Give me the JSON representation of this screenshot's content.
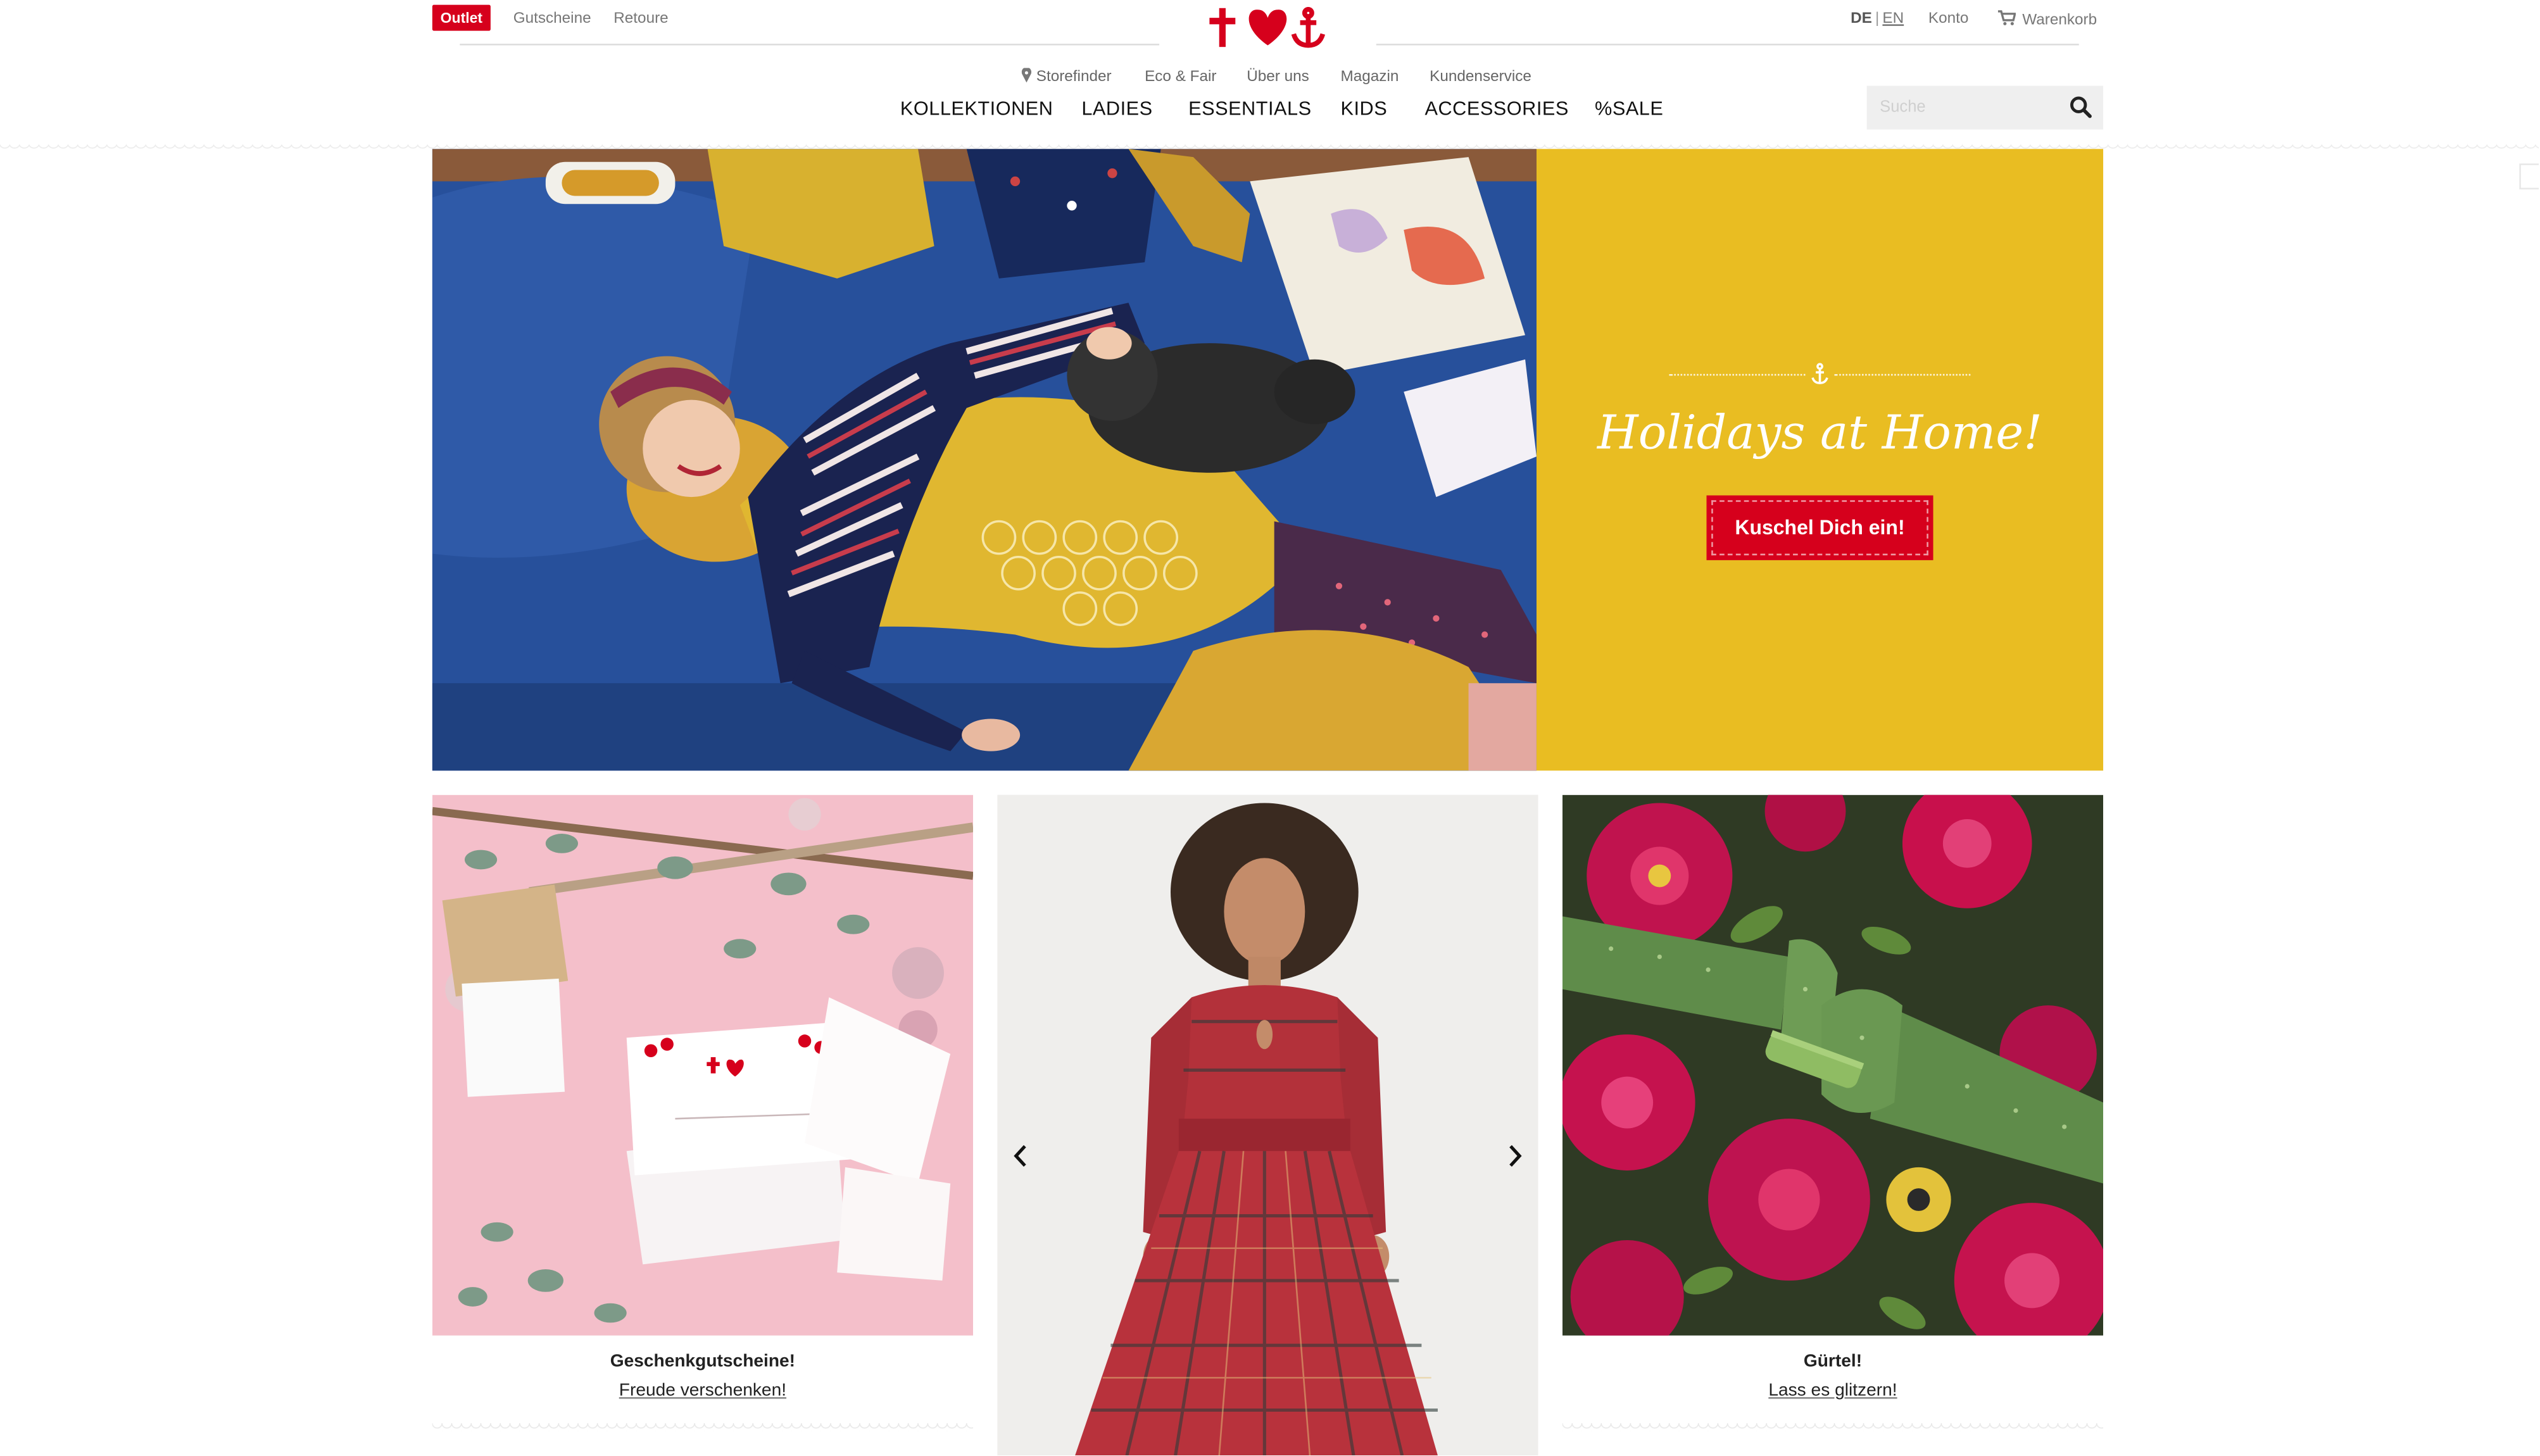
{
  "topbar": {
    "outlet": "Outlet",
    "gutscheine": "Gutscheine",
    "retoure": "Retoure",
    "lang_de": "DE",
    "lang_sep": "|",
    "lang_en": "EN",
    "konto": "Konto",
    "warenkorb": "Warenkorb"
  },
  "subnav": {
    "storefinder": "Storefinder",
    "eco": "Eco & Fair",
    "about": "Über uns",
    "magazin": "Magazin",
    "service": "Kundenservice"
  },
  "mainnav": {
    "kollektionen": "KOLLEKTIONEN",
    "ladies": "LADIES",
    "essentials": "ESSENTIALS",
    "kids": "KIDS",
    "accessories": "ACCESSORIES",
    "sale": "%SALE"
  },
  "search": {
    "placeholder": "Suche"
  },
  "hero": {
    "title": "Holidays at Home!",
    "cta": "Kuschel Dich ein!"
  },
  "tiles": [
    {
      "title": "Geschenkgutscheine!",
      "link": "Freude verschenken!"
    },
    {
      "title": "Gürtel!",
      "link": "Lass es glitzern!"
    }
  ],
  "colors": {
    "brand_red": "#d6001c",
    "hero_yellow": "#e9bd22",
    "sofa_blue": "#2a4f9a"
  },
  "icons": [
    "logo-cross-icon",
    "logo-heart-icon",
    "logo-anchor-icon",
    "pin-icon",
    "cart-icon",
    "search-icon",
    "anchor-icon",
    "chevron-left-icon",
    "chevron-right-icon"
  ]
}
